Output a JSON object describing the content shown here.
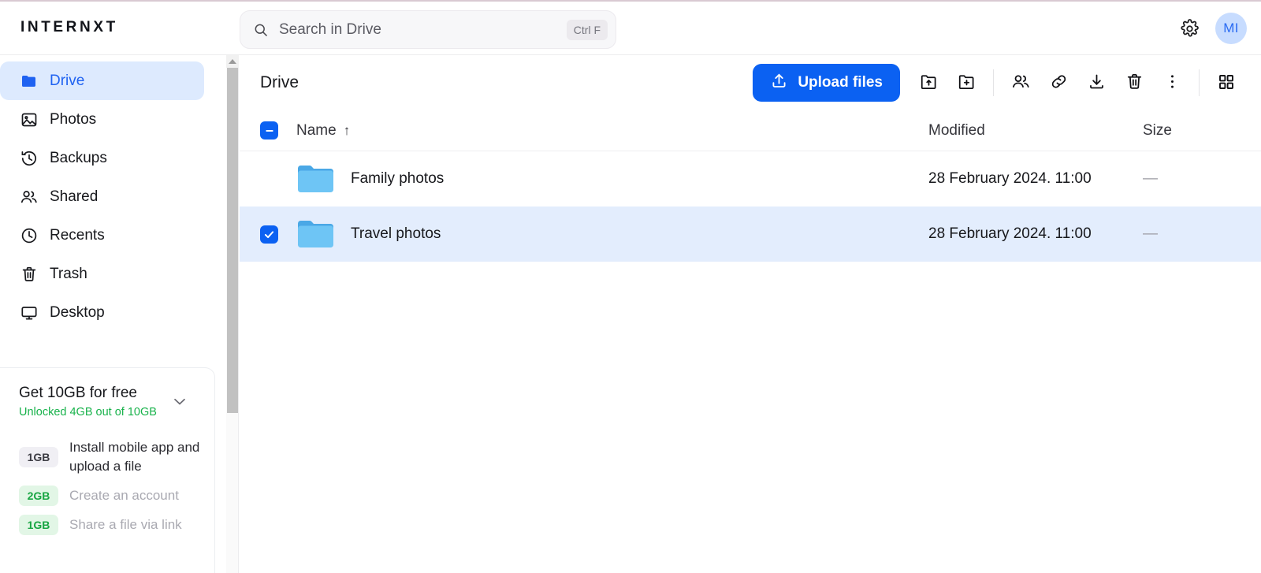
{
  "header": {
    "logo": "INTERNXT",
    "search": {
      "placeholder": "Search in Drive",
      "shortcut": "Ctrl F",
      "icon": "search-icon"
    },
    "settings_icon": "gear-icon",
    "avatar_initials": "MI"
  },
  "sidebar": {
    "items": [
      {
        "label": "Drive",
        "icon": "folder-icon",
        "active": true
      },
      {
        "label": "Photos",
        "icon": "image-icon",
        "active": false
      },
      {
        "label": "Backups",
        "icon": "history-icon",
        "active": false
      },
      {
        "label": "Shared",
        "icon": "people-icon",
        "active": false
      },
      {
        "label": "Recents",
        "icon": "clock-icon",
        "active": false
      },
      {
        "label": "Trash",
        "icon": "trash-icon",
        "active": false
      },
      {
        "label": "Desktop",
        "icon": "monitor-icon",
        "active": false
      }
    ],
    "promo": {
      "title": "Get 10GB for free",
      "subtitle": "Unlocked 4GB out of 10GB",
      "collapse_icon": "chevron-down-icon",
      "tasks": [
        {
          "badge": "1GB",
          "label": "Install mobile app and upload a file",
          "state": "active"
        },
        {
          "badge": "2GB",
          "label": "Create an account",
          "state": "done"
        },
        {
          "badge": "1GB",
          "label": "Share a file via link",
          "state": "done"
        }
      ]
    }
  },
  "main": {
    "breadcrumb": "Drive",
    "toolbar": {
      "upload_label": "Upload files",
      "upload_icon": "upload-icon",
      "buttons": [
        {
          "icon": "upload-folder-icon"
        },
        {
          "icon": "new-folder-icon"
        },
        {
          "icon": "share-people-icon"
        },
        {
          "icon": "link-icon"
        },
        {
          "icon": "download-icon"
        },
        {
          "icon": "trash-icon"
        },
        {
          "icon": "more-vertical-icon"
        },
        {
          "icon": "grid-view-icon"
        }
      ]
    },
    "table": {
      "select_all_state": "indeterminate",
      "columns": {
        "name": "Name",
        "sort_indicator": "↑",
        "modified": "Modified",
        "size": "Size"
      },
      "rows": [
        {
          "name": "Family photos",
          "icon": "folder-icon",
          "modified": "28 February 2024. 11:00",
          "size": "—",
          "selected": false
        },
        {
          "name": "Travel photos",
          "icon": "folder-icon",
          "modified": "28 February 2024. 11:00",
          "size": "—",
          "selected": true
        }
      ]
    }
  },
  "colors": {
    "accent": "#0b61f2",
    "accent_soft": "#ddeafe",
    "row_selected": "#e3edfd",
    "green": "#18b24b",
    "folder_body": "#6ec5f5",
    "folder_tab": "#4aa8e6"
  }
}
